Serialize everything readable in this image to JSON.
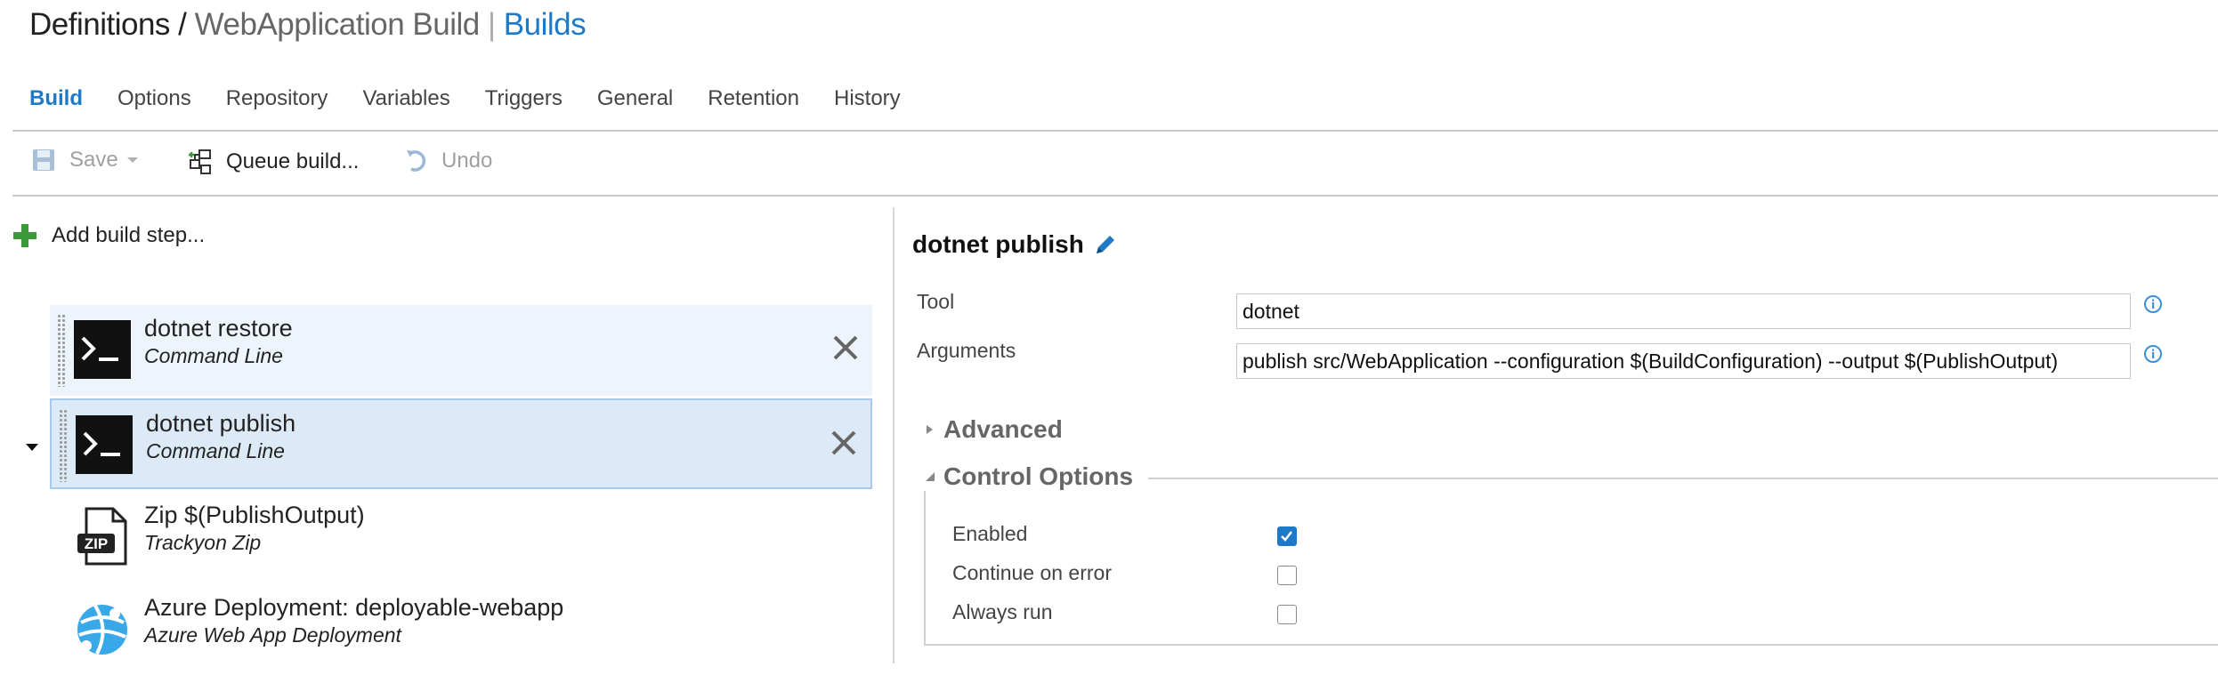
{
  "header": {
    "part1": "Definitions",
    "sep1": " / ",
    "part2": "WebApplication Build",
    "sep2": " | ",
    "part3": "Builds"
  },
  "tabs": [
    {
      "label": "Build",
      "active": true
    },
    {
      "label": "Options"
    },
    {
      "label": "Repository"
    },
    {
      "label": "Variables"
    },
    {
      "label": "Triggers"
    },
    {
      "label": "General"
    },
    {
      "label": "Retention"
    },
    {
      "label": "History"
    }
  ],
  "toolbar": {
    "save_label": "Save",
    "queue_label": "Queue build...",
    "undo_label": "Undo"
  },
  "left": {
    "add_step_label": "Add build step...",
    "steps": [
      {
        "name": "dotnet restore",
        "type": "Command Line",
        "icon": "terminal-icon"
      },
      {
        "name": "dotnet publish",
        "type": "Command Line",
        "icon": "terminal-icon",
        "selected": true
      },
      {
        "name": "Zip $(PublishOutput)",
        "type": "Trackyon Zip",
        "icon": "zip-file-icon"
      },
      {
        "name": "Azure Deployment: deployable-webapp",
        "type": "Azure Web App Deployment",
        "icon": "azure-globe-icon"
      }
    ]
  },
  "detail": {
    "title": "dotnet publish",
    "tool_label": "Tool",
    "tool_value": "dotnet",
    "arguments_label": "Arguments",
    "arguments_value": "publish src/WebApplication --configuration $(BuildConfiguration) --output $(PublishOutput)",
    "advanced_label": "Advanced",
    "control_options_label": "Control Options",
    "options": [
      {
        "label": "Enabled",
        "checked": true
      },
      {
        "label": "Continue on error",
        "checked": false
      },
      {
        "label": "Always run",
        "checked": false
      }
    ]
  },
  "colors": {
    "accent": "#1e7ac8",
    "selected_bg": "#dce9f7",
    "hover_bg": "#eef4fb",
    "add_green": "#3a9a3a"
  }
}
